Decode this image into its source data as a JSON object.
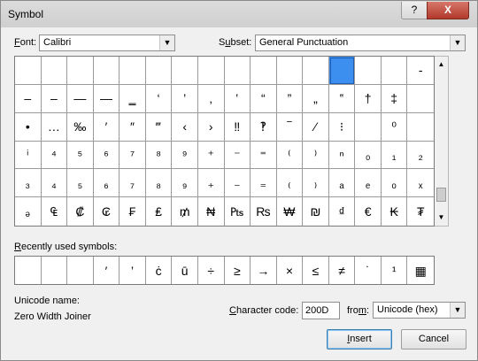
{
  "window": {
    "title": "Symbol",
    "help_label": "?",
    "close_label": "X"
  },
  "font": {
    "label": "Font:",
    "accel": "F",
    "rest": "ont:",
    "value": "Calibri"
  },
  "subset": {
    "label": "Subset:",
    "pre": "S",
    "accel": "u",
    "rest": "bset:",
    "value": "General Punctuation"
  },
  "symbol_grid": {
    "selected_index": 12,
    "rows": [
      [
        "",
        "",
        "",
        "",
        "",
        "",
        "",
        "",
        "",
        "",
        "",
        "",
        "",
        "",
        "",
        "-"
      ],
      [
        "‒",
        "–",
        "—",
        "―",
        "‗",
        "‘",
        "’",
        "‚",
        "‛",
        "“",
        "”",
        "„",
        "‟",
        "†",
        "‡",
        ""
      ],
      [
        "•",
        "…",
        "‰",
        "′",
        "″",
        "‴",
        "‹",
        "›",
        "‼",
        "‽",
        "‾",
        "⁄",
        "⁝",
        "",
        "⁰",
        ""
      ],
      [
        "ⁱ",
        "⁴",
        "⁵",
        "⁶",
        "⁷",
        "⁸",
        "⁹",
        "⁺",
        "⁻",
        "⁼",
        "⁽",
        "⁾",
        "ⁿ",
        "₀",
        "₁",
        "₂"
      ],
      [
        "₃",
        "₄",
        "₅",
        "₆",
        "₇",
        "₈",
        "₉",
        "₊",
        "₋",
        "₌",
        "₍",
        "₎",
        "ₐ",
        "ₑ",
        "ₒ",
        "ₓ"
      ],
      [
        "ₔ",
        "₠",
        "₡",
        "₢",
        "₣",
        "₤",
        "₥",
        "₦",
        "₧",
        "₨",
        "₩",
        "₪",
        "₫",
        "€",
        "₭",
        "₮"
      ]
    ]
  },
  "recent": {
    "label": "Recently used symbols:",
    "accel": "R",
    "rest": "ecently used symbols:",
    "symbols": [
      "",
      "",
      "",
      "′",
      "‛",
      "ċ",
      "ū",
      "÷",
      "≥",
      "→",
      "×",
      "≤",
      "≠",
      "˙",
      "¹",
      "▦"
    ]
  },
  "unicode_name": {
    "label": "Unicode name:",
    "value": "Zero Width Joiner"
  },
  "char_code": {
    "label": "Character code:",
    "accel": "C",
    "rest": "haracter code:",
    "value": "200D"
  },
  "from": {
    "label": "from:",
    "pre": "fro",
    "accel": "m",
    "rest": ":",
    "value": "Unicode (hex)"
  },
  "buttons": {
    "insert": "Insert",
    "insert_accel": "I",
    "insert_rest": "nsert",
    "cancel": "Cancel"
  },
  "colors": {
    "selection": "#3d8fef",
    "close_button": "#c0483a"
  }
}
